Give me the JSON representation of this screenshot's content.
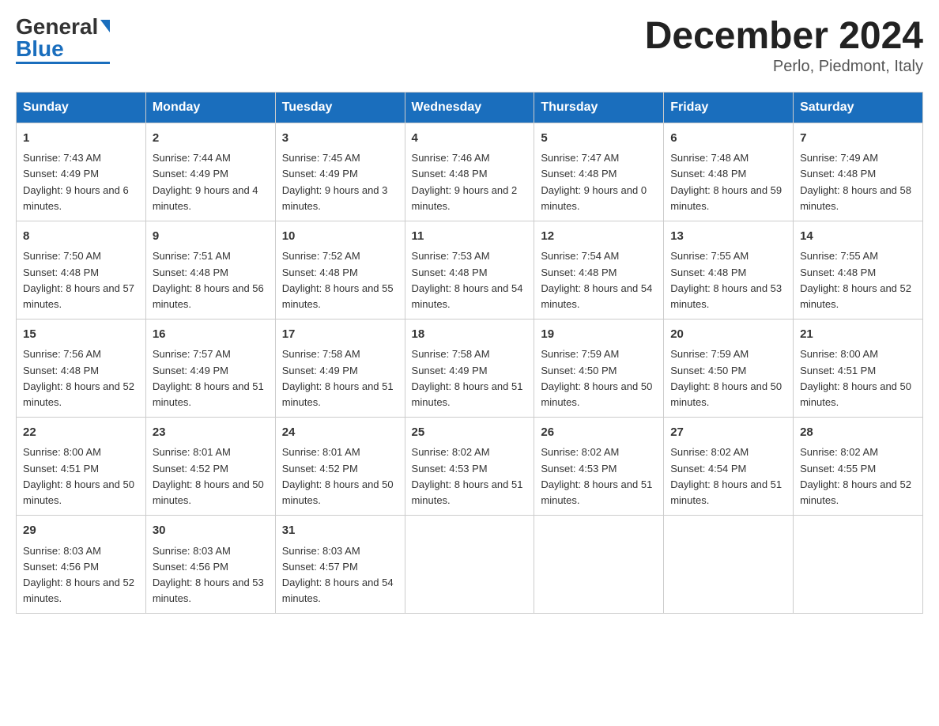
{
  "header": {
    "logo_general": "General",
    "logo_blue": "Blue",
    "month_title": "December 2024",
    "subtitle": "Perlo, Piedmont, Italy"
  },
  "weekdays": [
    "Sunday",
    "Monday",
    "Tuesday",
    "Wednesday",
    "Thursday",
    "Friday",
    "Saturday"
  ],
  "weeks": [
    [
      {
        "day": "1",
        "sunrise": "7:43 AM",
        "sunset": "4:49 PM",
        "daylight": "9 hours and 6 minutes."
      },
      {
        "day": "2",
        "sunrise": "7:44 AM",
        "sunset": "4:49 PM",
        "daylight": "9 hours and 4 minutes."
      },
      {
        "day": "3",
        "sunrise": "7:45 AM",
        "sunset": "4:49 PM",
        "daylight": "9 hours and 3 minutes."
      },
      {
        "day": "4",
        "sunrise": "7:46 AM",
        "sunset": "4:48 PM",
        "daylight": "9 hours and 2 minutes."
      },
      {
        "day": "5",
        "sunrise": "7:47 AM",
        "sunset": "4:48 PM",
        "daylight": "9 hours and 0 minutes."
      },
      {
        "day": "6",
        "sunrise": "7:48 AM",
        "sunset": "4:48 PM",
        "daylight": "8 hours and 59 minutes."
      },
      {
        "day": "7",
        "sunrise": "7:49 AM",
        "sunset": "4:48 PM",
        "daylight": "8 hours and 58 minutes."
      }
    ],
    [
      {
        "day": "8",
        "sunrise": "7:50 AM",
        "sunset": "4:48 PM",
        "daylight": "8 hours and 57 minutes."
      },
      {
        "day": "9",
        "sunrise": "7:51 AM",
        "sunset": "4:48 PM",
        "daylight": "8 hours and 56 minutes."
      },
      {
        "day": "10",
        "sunrise": "7:52 AM",
        "sunset": "4:48 PM",
        "daylight": "8 hours and 55 minutes."
      },
      {
        "day": "11",
        "sunrise": "7:53 AM",
        "sunset": "4:48 PM",
        "daylight": "8 hours and 54 minutes."
      },
      {
        "day": "12",
        "sunrise": "7:54 AM",
        "sunset": "4:48 PM",
        "daylight": "8 hours and 54 minutes."
      },
      {
        "day": "13",
        "sunrise": "7:55 AM",
        "sunset": "4:48 PM",
        "daylight": "8 hours and 53 minutes."
      },
      {
        "day": "14",
        "sunrise": "7:55 AM",
        "sunset": "4:48 PM",
        "daylight": "8 hours and 52 minutes."
      }
    ],
    [
      {
        "day": "15",
        "sunrise": "7:56 AM",
        "sunset": "4:48 PM",
        "daylight": "8 hours and 52 minutes."
      },
      {
        "day": "16",
        "sunrise": "7:57 AM",
        "sunset": "4:49 PM",
        "daylight": "8 hours and 51 minutes."
      },
      {
        "day": "17",
        "sunrise": "7:58 AM",
        "sunset": "4:49 PM",
        "daylight": "8 hours and 51 minutes."
      },
      {
        "day": "18",
        "sunrise": "7:58 AM",
        "sunset": "4:49 PM",
        "daylight": "8 hours and 51 minutes."
      },
      {
        "day": "19",
        "sunrise": "7:59 AM",
        "sunset": "4:50 PM",
        "daylight": "8 hours and 50 minutes."
      },
      {
        "day": "20",
        "sunrise": "7:59 AM",
        "sunset": "4:50 PM",
        "daylight": "8 hours and 50 minutes."
      },
      {
        "day": "21",
        "sunrise": "8:00 AM",
        "sunset": "4:51 PM",
        "daylight": "8 hours and 50 minutes."
      }
    ],
    [
      {
        "day": "22",
        "sunrise": "8:00 AM",
        "sunset": "4:51 PM",
        "daylight": "8 hours and 50 minutes."
      },
      {
        "day": "23",
        "sunrise": "8:01 AM",
        "sunset": "4:52 PM",
        "daylight": "8 hours and 50 minutes."
      },
      {
        "day": "24",
        "sunrise": "8:01 AM",
        "sunset": "4:52 PM",
        "daylight": "8 hours and 50 minutes."
      },
      {
        "day": "25",
        "sunrise": "8:02 AM",
        "sunset": "4:53 PM",
        "daylight": "8 hours and 51 minutes."
      },
      {
        "day": "26",
        "sunrise": "8:02 AM",
        "sunset": "4:53 PM",
        "daylight": "8 hours and 51 minutes."
      },
      {
        "day": "27",
        "sunrise": "8:02 AM",
        "sunset": "4:54 PM",
        "daylight": "8 hours and 51 minutes."
      },
      {
        "day": "28",
        "sunrise": "8:02 AM",
        "sunset": "4:55 PM",
        "daylight": "8 hours and 52 minutes."
      }
    ],
    [
      {
        "day": "29",
        "sunrise": "8:03 AM",
        "sunset": "4:56 PM",
        "daylight": "8 hours and 52 minutes."
      },
      {
        "day": "30",
        "sunrise": "8:03 AM",
        "sunset": "4:56 PM",
        "daylight": "8 hours and 53 minutes."
      },
      {
        "day": "31",
        "sunrise": "8:03 AM",
        "sunset": "4:57 PM",
        "daylight": "8 hours and 54 minutes."
      },
      null,
      null,
      null,
      null
    ]
  ]
}
